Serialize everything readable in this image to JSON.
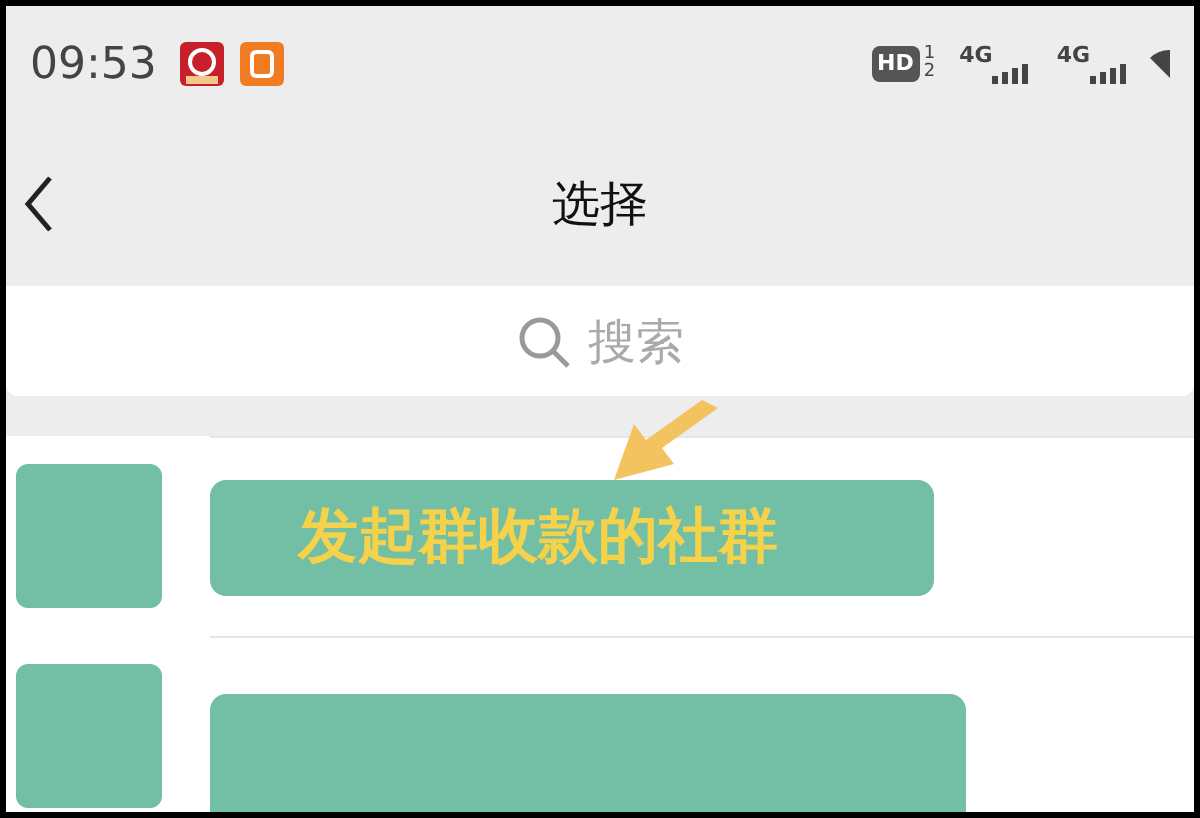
{
  "status_bar": {
    "time": "09:53",
    "hd": {
      "label": "HD",
      "sims": [
        "1",
        "2"
      ]
    },
    "networks": [
      "4G",
      "4G"
    ]
  },
  "header": {
    "title": "选择"
  },
  "search": {
    "placeholder": "搜索"
  },
  "rows": [
    {
      "kind": "labeled",
      "label": "发起群收款的社群"
    },
    {
      "kind": "blank"
    }
  ]
}
